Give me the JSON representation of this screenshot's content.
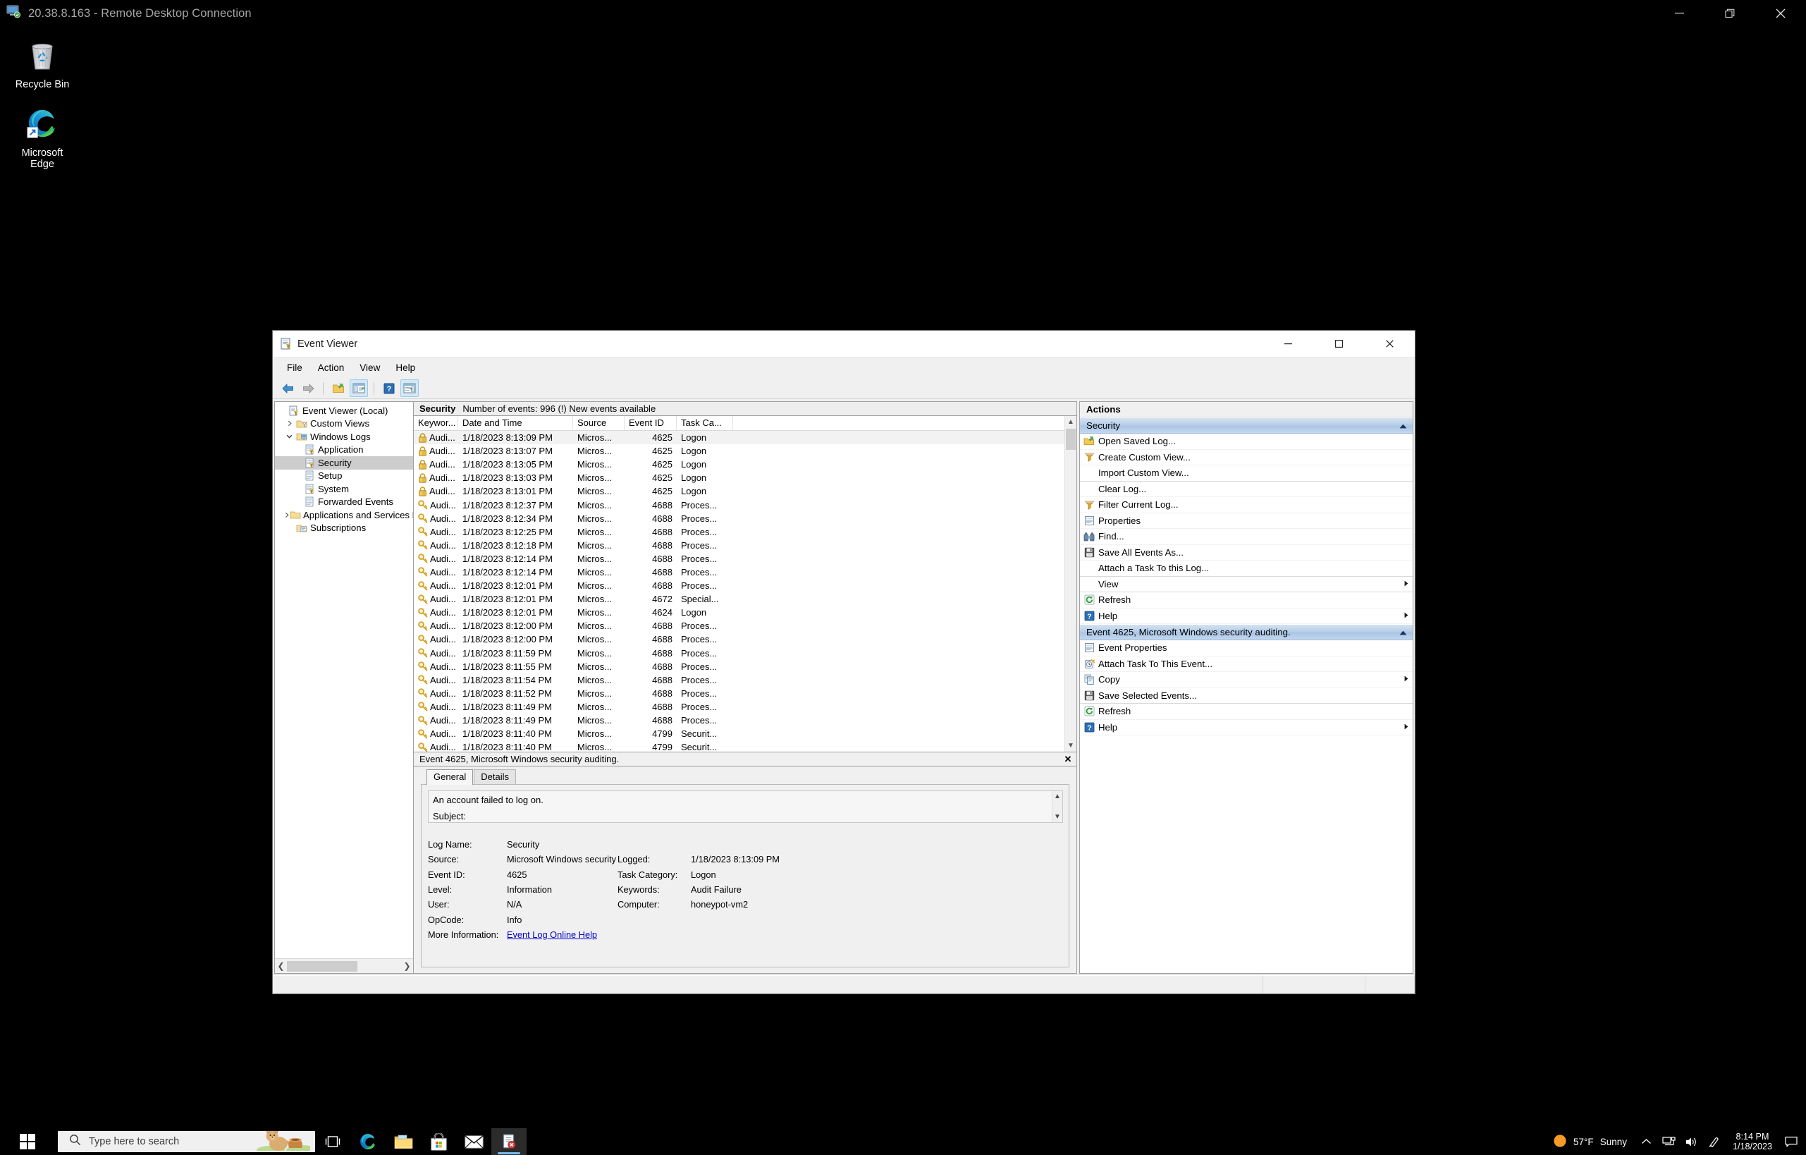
{
  "rdp": {
    "title": "20.38.8.163 - Remote Desktop Connection",
    "minimize": "Minimize",
    "restore": "Restore",
    "close": "Close"
  },
  "desktop": {
    "icons": [
      {
        "label": "Recycle Bin",
        "icon": "recycle-bin-icon"
      },
      {
        "label": "Microsoft\nEdge",
        "label_line1": "Microsoft",
        "label_line2": "Edge",
        "icon": "microsoft-edge-icon"
      }
    ]
  },
  "event_viewer": {
    "title": "Event Viewer",
    "menu": [
      "File",
      "Action",
      "View",
      "Help"
    ],
    "toolbar": [
      {
        "name": "back-button",
        "label": "Back"
      },
      {
        "name": "forward-button",
        "label": "Forward"
      },
      {
        "name": "open-folder-button",
        "label": "Open"
      },
      {
        "name": "show-hide-console-tree-button",
        "label": "Show/Hide Console Tree"
      },
      {
        "name": "help-button",
        "label": "Help"
      },
      {
        "name": "show-hide-action-pane-button",
        "label": "Show/Hide Action Pane"
      }
    ],
    "tree": [
      {
        "label": "Event Viewer (Local)",
        "depth": 0,
        "expander": "",
        "icon": "event-viewer-icon",
        "selected": false
      },
      {
        "label": "Custom Views",
        "depth": 1,
        "expander": "collapsed",
        "icon": "custom-views-folder-icon",
        "selected": false
      },
      {
        "label": "Windows Logs",
        "depth": 1,
        "expander": "expanded",
        "icon": "windows-logs-folder-icon",
        "selected": false
      },
      {
        "label": "Application",
        "depth": 2,
        "expander": "",
        "icon": "log-icon",
        "selected": false
      },
      {
        "label": "Security",
        "depth": 2,
        "expander": "",
        "icon": "log-icon",
        "selected": true
      },
      {
        "label": "Setup",
        "depth": 2,
        "expander": "",
        "icon": "log-plain-icon",
        "selected": false
      },
      {
        "label": "System",
        "depth": 2,
        "expander": "",
        "icon": "log-icon",
        "selected": false
      },
      {
        "label": "Forwarded Events",
        "depth": 2,
        "expander": "",
        "icon": "log-plain-icon",
        "selected": false
      },
      {
        "label": "Applications and Services Lo",
        "depth": 1,
        "expander": "collapsed",
        "icon": "folder-icon",
        "selected": false
      },
      {
        "label": "Subscriptions",
        "depth": 1,
        "expander": "",
        "icon": "subscriptions-icon",
        "selected": false
      }
    ],
    "log_header": {
      "name": "Security",
      "count": "Number of events: 996 (!) New events available"
    },
    "columns": [
      "Keywor...",
      "Date and Time",
      "Source",
      "Event ID",
      "Task Ca..."
    ],
    "rows": [
      {
        "keywords": "Audi...",
        "icon": "lock-icon",
        "date": "1/18/2023 8:13:09 PM",
        "source": "Micros...",
        "event_id": "4625",
        "task": "Logon",
        "selected": true
      },
      {
        "keywords": "Audi...",
        "icon": "lock-icon",
        "date": "1/18/2023 8:13:07 PM",
        "source": "Micros...",
        "event_id": "4625",
        "task": "Logon",
        "selected": false
      },
      {
        "keywords": "Audi...",
        "icon": "lock-icon",
        "date": "1/18/2023 8:13:05 PM",
        "source": "Micros...",
        "event_id": "4625",
        "task": "Logon",
        "selected": false
      },
      {
        "keywords": "Audi...",
        "icon": "lock-icon",
        "date": "1/18/2023 8:13:03 PM",
        "source": "Micros...",
        "event_id": "4625",
        "task": "Logon",
        "selected": false
      },
      {
        "keywords": "Audi...",
        "icon": "lock-icon",
        "date": "1/18/2023 8:13:01 PM",
        "source": "Micros...",
        "event_id": "4625",
        "task": "Logon",
        "selected": false
      },
      {
        "keywords": "Audi...",
        "icon": "key-icon",
        "date": "1/18/2023 8:12:37 PM",
        "source": "Micros...",
        "event_id": "4688",
        "task": "Proces...",
        "selected": false
      },
      {
        "keywords": "Audi...",
        "icon": "key-icon",
        "date": "1/18/2023 8:12:34 PM",
        "source": "Micros...",
        "event_id": "4688",
        "task": "Proces...",
        "selected": false
      },
      {
        "keywords": "Audi...",
        "icon": "key-icon",
        "date": "1/18/2023 8:12:25 PM",
        "source": "Micros...",
        "event_id": "4688",
        "task": "Proces...",
        "selected": false
      },
      {
        "keywords": "Audi...",
        "icon": "key-icon",
        "date": "1/18/2023 8:12:18 PM",
        "source": "Micros...",
        "event_id": "4688",
        "task": "Proces...",
        "selected": false
      },
      {
        "keywords": "Audi...",
        "icon": "key-icon",
        "date": "1/18/2023 8:12:14 PM",
        "source": "Micros...",
        "event_id": "4688",
        "task": "Proces...",
        "selected": false
      },
      {
        "keywords": "Audi...",
        "icon": "key-icon",
        "date": "1/18/2023 8:12:14 PM",
        "source": "Micros...",
        "event_id": "4688",
        "task": "Proces...",
        "selected": false
      },
      {
        "keywords": "Audi...",
        "icon": "key-icon",
        "date": "1/18/2023 8:12:01 PM",
        "source": "Micros...",
        "event_id": "4688",
        "task": "Proces...",
        "selected": false
      },
      {
        "keywords": "Audi...",
        "icon": "key-icon",
        "date": "1/18/2023 8:12:01 PM",
        "source": "Micros...",
        "event_id": "4672",
        "task": "Special...",
        "selected": false
      },
      {
        "keywords": "Audi...",
        "icon": "key-icon",
        "date": "1/18/2023 8:12:01 PM",
        "source": "Micros...",
        "event_id": "4624",
        "task": "Logon",
        "selected": false
      },
      {
        "keywords": "Audi...",
        "icon": "key-icon",
        "date": "1/18/2023 8:12:00 PM",
        "source": "Micros...",
        "event_id": "4688",
        "task": "Proces...",
        "selected": false
      },
      {
        "keywords": "Audi...",
        "icon": "key-icon",
        "date": "1/18/2023 8:12:00 PM",
        "source": "Micros...",
        "event_id": "4688",
        "task": "Proces...",
        "selected": false
      },
      {
        "keywords": "Audi...",
        "icon": "key-icon",
        "date": "1/18/2023 8:11:59 PM",
        "source": "Micros...",
        "event_id": "4688",
        "task": "Proces...",
        "selected": false
      },
      {
        "keywords": "Audi...",
        "icon": "key-icon",
        "date": "1/18/2023 8:11:55 PM",
        "source": "Micros...",
        "event_id": "4688",
        "task": "Proces...",
        "selected": false
      },
      {
        "keywords": "Audi...",
        "icon": "key-icon",
        "date": "1/18/2023 8:11:54 PM",
        "source": "Micros...",
        "event_id": "4688",
        "task": "Proces...",
        "selected": false
      },
      {
        "keywords": "Audi...",
        "icon": "key-icon",
        "date": "1/18/2023 8:11:52 PM",
        "source": "Micros...",
        "event_id": "4688",
        "task": "Proces...",
        "selected": false
      },
      {
        "keywords": "Audi...",
        "icon": "key-icon",
        "date": "1/18/2023 8:11:49 PM",
        "source": "Micros...",
        "event_id": "4688",
        "task": "Proces...",
        "selected": false
      },
      {
        "keywords": "Audi...",
        "icon": "key-icon",
        "date": "1/18/2023 8:11:49 PM",
        "source": "Micros...",
        "event_id": "4688",
        "task": "Proces...",
        "selected": false
      },
      {
        "keywords": "Audi...",
        "icon": "key-icon",
        "date": "1/18/2023 8:11:40 PM",
        "source": "Micros...",
        "event_id": "4799",
        "task": "Securit...",
        "selected": false
      },
      {
        "keywords": "Audi...",
        "icon": "key-icon",
        "date": "1/18/2023 8:11:40 PM",
        "source": "Micros...",
        "event_id": "4799",
        "task": "Securit...",
        "selected": false
      }
    ],
    "detail": {
      "header": "Event 4625, Microsoft Windows security auditing.",
      "close_label": "Close",
      "tabs": [
        {
          "label": "General",
          "active": true
        },
        {
          "label": "Details",
          "active": false
        }
      ],
      "description_line1": "An account failed to log on.",
      "description_line2": "Subject:",
      "properties": [
        {
          "label": "Log Name:",
          "value": "Security",
          "label2": "",
          "value2": ""
        },
        {
          "label": "Source:",
          "value": "Microsoft Windows security",
          "label2": "Logged:",
          "value2": "1/18/2023 8:13:09 PM"
        },
        {
          "label": "Event ID:",
          "value": "4625",
          "label2": "Task Category:",
          "value2": "Logon"
        },
        {
          "label": "Level:",
          "value": "Information",
          "label2": "Keywords:",
          "value2": "Audit Failure"
        },
        {
          "label": "User:",
          "value": "N/A",
          "label2": "Computer:",
          "value2": "honeypot-vm2"
        },
        {
          "label": "OpCode:",
          "value": "Info",
          "label2": "",
          "value2": ""
        }
      ],
      "more_info_label": "More Information:",
      "more_info_link": "Event Log Online Help"
    },
    "actions": {
      "title": "Actions",
      "sections": [
        {
          "title": "Security",
          "items": [
            {
              "label": "Open Saved Log...",
              "icon": "open-folder-icon",
              "arrow": false,
              "separator_after": false
            },
            {
              "label": "Create Custom View...",
              "icon": "filter-icon",
              "arrow": false,
              "separator_after": false
            },
            {
              "label": "Import Custom View...",
              "icon": "",
              "arrow": false,
              "separator_after": true
            },
            {
              "label": "Clear Log...",
              "icon": "",
              "arrow": false,
              "separator_after": false
            },
            {
              "label": "Filter Current Log...",
              "icon": "filter-icon",
              "arrow": false,
              "separator_after": false
            },
            {
              "label": "Properties",
              "icon": "properties-icon",
              "arrow": false,
              "separator_after": false
            },
            {
              "label": "Find...",
              "icon": "binoculars-icon",
              "arrow": false,
              "separator_after": false
            },
            {
              "label": "Save All Events As...",
              "icon": "save-icon",
              "arrow": false,
              "separator_after": false
            },
            {
              "label": "Attach a Task To this Log...",
              "icon": "",
              "arrow": false,
              "separator_after": true
            },
            {
              "label": "View",
              "icon": "",
              "arrow": true,
              "separator_after": true
            },
            {
              "label": "Refresh",
              "icon": "refresh-icon",
              "arrow": false,
              "separator_after": false
            },
            {
              "label": "Help",
              "icon": "help-icon",
              "arrow": true,
              "separator_after": false
            }
          ]
        },
        {
          "title": "Event 4625, Microsoft Windows security auditing.",
          "items": [
            {
              "label": "Event Properties",
              "icon": "properties-icon",
              "arrow": false,
              "separator_after": false
            },
            {
              "label": "Attach Task To This Event...",
              "icon": "attach-task-icon",
              "arrow": false,
              "separator_after": false
            },
            {
              "label": "Copy",
              "icon": "copy-icon",
              "arrow": true,
              "separator_after": false
            },
            {
              "label": "Save Selected Events...",
              "icon": "save-icon",
              "arrow": false,
              "separator_after": true
            },
            {
              "label": "Refresh",
              "icon": "refresh-icon",
              "arrow": false,
              "separator_after": false
            },
            {
              "label": "Help",
              "icon": "help-icon",
              "arrow": true,
              "separator_after": false
            }
          ]
        }
      ]
    }
  },
  "taskbar": {
    "start_label": "Start",
    "search_placeholder": "Type here to search",
    "apps": [
      {
        "name": "task-view-button",
        "label": "Task View",
        "active": false
      },
      {
        "name": "taskbar-edge-button",
        "label": "Microsoft Edge",
        "active": false
      },
      {
        "name": "taskbar-file-explorer-button",
        "label": "File Explorer",
        "active": false
      },
      {
        "name": "taskbar-microsoft-store-button",
        "label": "Microsoft Store",
        "active": false
      },
      {
        "name": "taskbar-mail-button",
        "label": "Mail",
        "active": false
      },
      {
        "name": "taskbar-event-viewer-button",
        "label": "Event Viewer",
        "active": true
      }
    ],
    "tray": {
      "weather_temp": "57°F",
      "weather_cond": "Sunny",
      "show_hidden_label": "Show hidden icons",
      "network_label": "Network",
      "volume_label": "Volume",
      "pen_label": "Windows Ink Workspace",
      "time": "8:14 PM",
      "date": "1/18/2023",
      "notifications_label": "Notifications"
    }
  }
}
